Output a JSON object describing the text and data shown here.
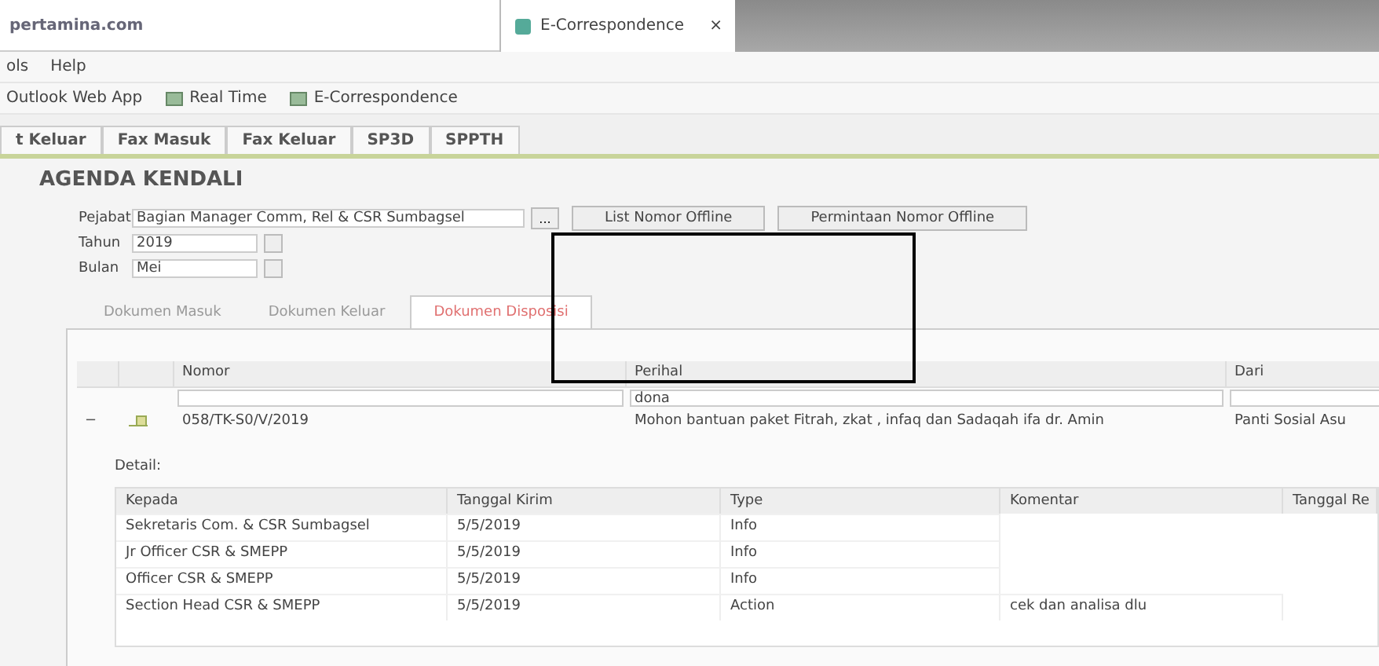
{
  "browser": {
    "address": "pertamina.com",
    "tab": {
      "title": "E-Correspondence",
      "close": "×"
    }
  },
  "menu": [
    "ols",
    "Help"
  ],
  "favorites": [
    "Outlook Web App",
    "Real Time",
    "E-Correspondence"
  ],
  "app_tabs": [
    "t Keluar",
    "Fax Masuk",
    "Fax Keluar",
    "SP3D",
    "SPPTH"
  ],
  "title": "AGENDA KENDALI",
  "form": {
    "pejabat": {
      "label": "Pejabat",
      "value": "Bagian Manager Comm, Rel & CSR Sumbagsel",
      "button": "..."
    },
    "tahun": {
      "label": "Tahun",
      "value": "2019"
    },
    "bulan": {
      "label": "Bulan",
      "value": "Mei"
    },
    "buttons": [
      "List Nomor Offline",
      "Permintaan Nomor Offline"
    ]
  },
  "doc_tabs": [
    {
      "label": "Dokumen Masuk",
      "selected": false
    },
    {
      "label": "Dokumen Keluar",
      "selected": false
    },
    {
      "label": "Dokumen Disposisi",
      "selected": true
    }
  ],
  "grid": {
    "columns": [
      "Nomor",
      "Perihal",
      "Dari"
    ],
    "perihal_filter": "dona",
    "rows": [
      {
        "expanded": true,
        "toggle": "−",
        "cells": [
          "058/TK-S0/V/2019",
          "Mohon bantuan paket Fitrah, zkat , infaq dan Sadaqah ifa dr. Amin",
          "Panti Sosial Asu"
        ]
      }
    ]
  },
  "detail": {
    "label": "Detail:",
    "columns": [
      "Kepada",
      "Tanggal Kirim",
      "Type",
      "Komentar",
      "Tanggal Re"
    ],
    "rows": [
      [
        "Sekretaris Com. & CSR Sumbagsel",
        "5/5/2019",
        "Info",
        "",
        ""
      ],
      [
        "Jr Officer CSR & SMEPP",
        "5/5/2019",
        "Info",
        "",
        ""
      ],
      [
        "Officer CSR & SMEPP",
        "5/5/2019",
        "Info",
        "",
        ""
      ],
      [
        "Section Head CSR & SMEPP",
        "5/5/2019",
        "Action",
        "cek dan analisa dlu",
        ""
      ]
    ]
  }
}
